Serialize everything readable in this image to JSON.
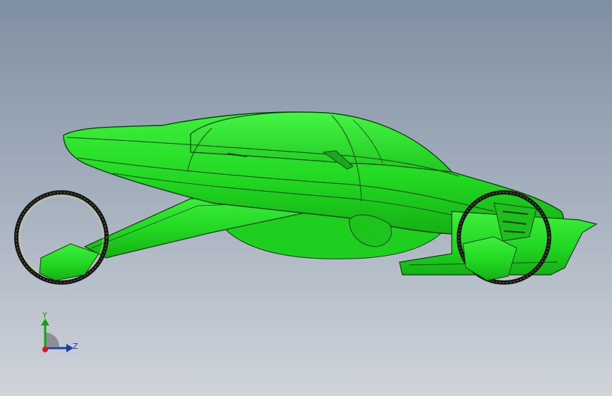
{
  "viewport": {
    "background_top": "#7f8fa2",
    "background_bottom": "#cfd4db"
  },
  "model": {
    "body_color": "#22e022",
    "edge_color": "#0b3d0b",
    "tire_color": "#151515"
  },
  "triad": {
    "axis_y_label": "Y",
    "axis_z_label": "Z",
    "y_color": "#1a9f1a",
    "z_color": "#1b3d9c",
    "origin_color": "#d11a1a"
  }
}
